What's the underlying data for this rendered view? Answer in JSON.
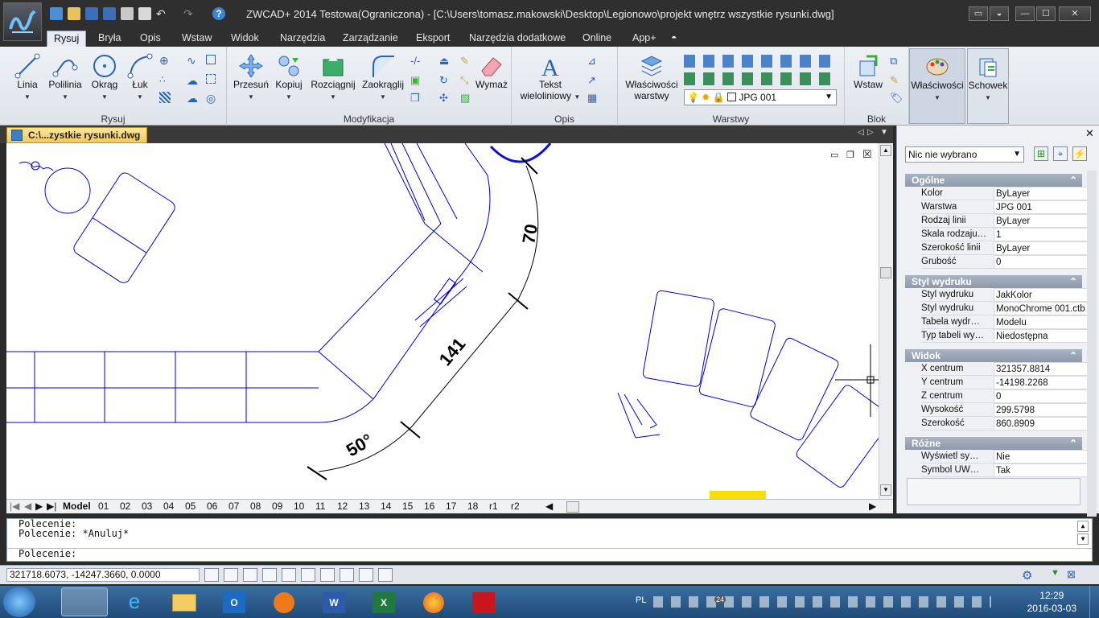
{
  "app": {
    "title": "ZWCAD+ 2014 Testowa(Ograniczona) - [C:\\Users\\tomasz.makowski\\Desktop\\Legionowo\\projekt wnętrz wszystkie rysunki.dwg]",
    "window_buttons": [
      "▭",
      "—",
      "☐",
      "✕"
    ]
  },
  "ribbon_tabs": [
    "Rysuj",
    "Bryła",
    "Opis",
    "Wstaw",
    "Widok",
    "Narzędzia",
    "Zarządzanie",
    "Eksport",
    "Narzędzia dodatkowe",
    "Online",
    "App+"
  ],
  "ribbon": {
    "groups": {
      "rysuj": "Rysuj",
      "modyfikacja": "Modyfikacja",
      "opis": "Opis",
      "warstwy": "Warstwy",
      "blok": "Blok"
    },
    "buttons": {
      "linia": "Linia",
      "polilinia": "Polilinia",
      "okrag": "Okrąg",
      "luk": "Łuk",
      "przesun": "Przesuń",
      "kopiuj": "Kopiuj",
      "rozciagnij": "Rozciągnij",
      "zaokraglij": "Zaokrąglij",
      "wymaz": "Wymaż",
      "tekst_line1": "Tekst",
      "tekst_line2": "wieloliniowy",
      "wlasciwosci_warstwy_1": "Właściwości",
      "wlasciwosci_warstwy_2": "warstwy",
      "wstaw": "Wstaw",
      "wlasciwosci": "Właściwości",
      "schowek": "Schowek"
    },
    "layer_combo": "JPG 001"
  },
  "document_tab": "C:\\...zystkie rysunki.dwg",
  "drawing": {
    "dimensions": [
      "70",
      "141",
      "50°"
    ]
  },
  "layout_tabs": [
    "Model",
    "01",
    "02",
    "03",
    "04",
    "05",
    "06",
    "07",
    "08",
    "09",
    "10",
    "11",
    "12",
    "13",
    "14",
    "15",
    "16",
    "17",
    "18",
    "r1",
    "r2"
  ],
  "properties": {
    "selection": "Nic nie wybrano",
    "sections": [
      {
        "title": "Ogólne",
        "rows": [
          {
            "k": "Kolor",
            "v": "ByLayer"
          },
          {
            "k": "Warstwa",
            "v": "JPG 001"
          },
          {
            "k": "Rodzaj linii",
            "v": "ByLayer"
          },
          {
            "k": "Skala rodzaju…",
            "v": "1"
          },
          {
            "k": "Szerokość linii",
            "v": "ByLayer"
          },
          {
            "k": "Grubość",
            "v": "0"
          }
        ]
      },
      {
        "title": "Styl wydruku",
        "rows": [
          {
            "k": "Styl wydruku",
            "v": "JakKolor"
          },
          {
            "k": "Styl wydruku",
            "v": "MonoChrome 001.ctb"
          },
          {
            "k": "Tabela wydr…",
            "v": "Modelu"
          },
          {
            "k": "Typ tabeli wy…",
            "v": "Niedostępna"
          }
        ]
      },
      {
        "title": "Widok",
        "rows": [
          {
            "k": "X centrum",
            "v": "321357.8814"
          },
          {
            "k": "Y centrum",
            "v": "-14198.2268"
          },
          {
            "k": "Z centrum",
            "v": "0"
          },
          {
            "k": "Wysokość",
            "v": "299.5798"
          },
          {
            "k": "Szerokość",
            "v": "860.8909"
          }
        ]
      },
      {
        "title": "Różne",
        "rows": [
          {
            "k": "Wyświetl sy…",
            "v": "Nie"
          },
          {
            "k": "Symbol UW…",
            "v": "Tak"
          }
        ]
      }
    ]
  },
  "command_line": [
    "Polecenie:",
    "Polecenie: *Anuluj*",
    "",
    "Polecenie:"
  ],
  "status": {
    "coords": "321718.6073, -14247.3660, 0.0000"
  },
  "taskbar": {
    "lang": "PL",
    "time": "12:29",
    "date": "2016-03-03",
    "badge": "24"
  },
  "colors": {
    "accent_blue": "#0000cc",
    "tab_active": "#f3c95a"
  }
}
